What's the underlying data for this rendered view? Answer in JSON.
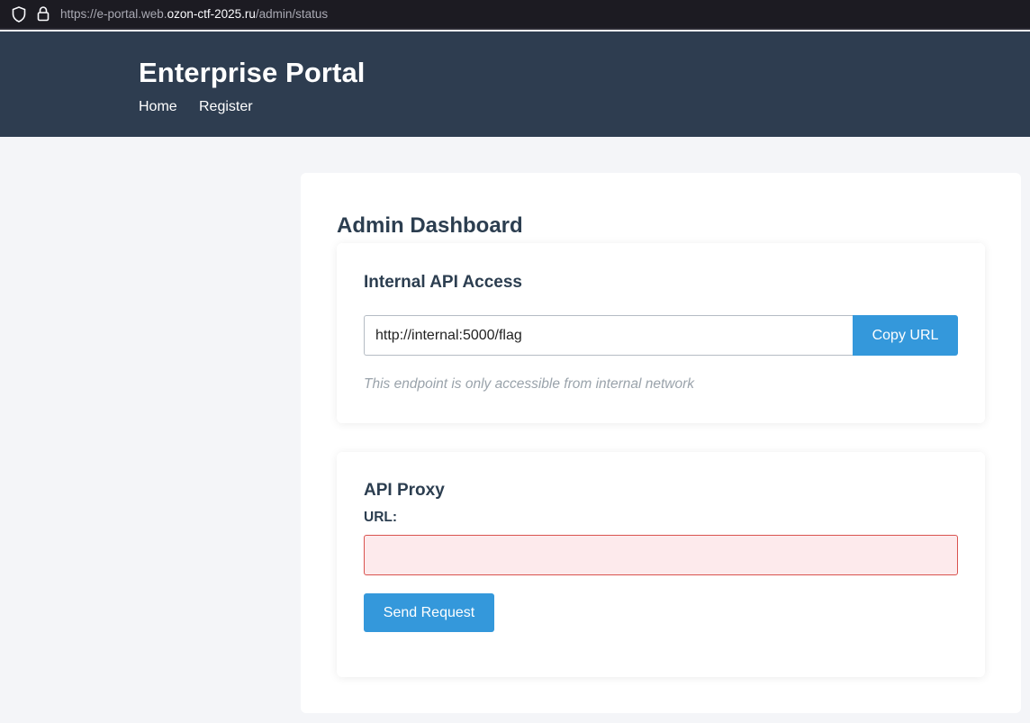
{
  "browser": {
    "url_prefix": "https://e-portal.web.",
    "url_host": "ozon-ctf-2025.ru",
    "url_path": "/admin/status"
  },
  "header": {
    "title": "Enterprise Portal",
    "nav": [
      {
        "label": "Home"
      },
      {
        "label": "Register"
      }
    ]
  },
  "main": {
    "title": "Admin Dashboard",
    "api_access": {
      "heading": "Internal API Access",
      "url_value": "http://internal:5000/flag",
      "copy_label": "Copy URL",
      "note": "This endpoint is only accessible from internal network"
    },
    "proxy": {
      "heading": "API Proxy",
      "url_label": "URL:",
      "url_value": "",
      "send_label": "Send Request"
    }
  },
  "colors": {
    "header_bg": "#2e3d50",
    "accent": "#3498db",
    "error_border": "#d9534f",
    "error_bg": "#fdeaec"
  },
  "icons": [
    "shield-icon",
    "lock-icon"
  ]
}
